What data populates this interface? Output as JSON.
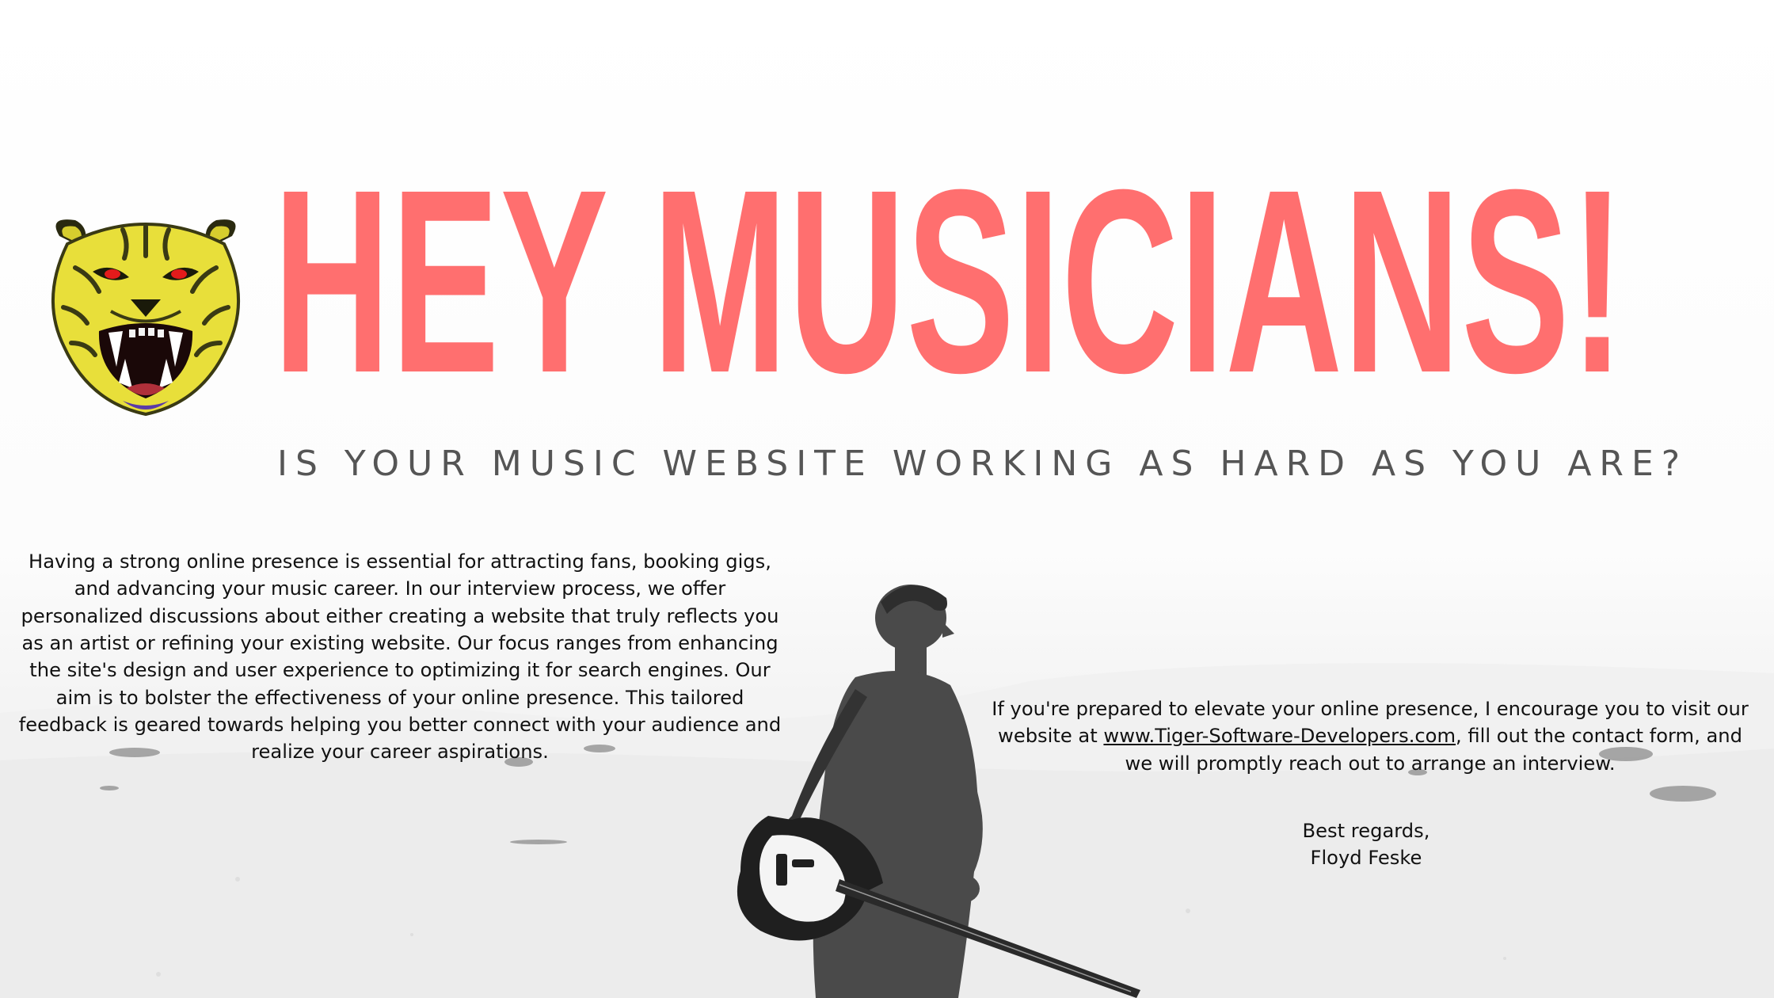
{
  "headline": "HEY MUSICIANS!",
  "subheading": "IS YOUR MUSIC WEBSITE WORKING AS HARD AS YOU ARE?",
  "intro_paragraph": "Having a strong online presence is essential for attracting fans, booking gigs, and advancing your music career. In our interview process, we offer personalized discussions about either creating a website that truly reflects you as an artist or refining your existing website. Our focus ranges from enhancing the site's design and user experience to optimizing it for search engines. Our aim is to bolster the effectiveness of your online presence. This tailored feedback is geared towards helping you better connect with your audience and realize your career aspirations.",
  "cta": {
    "before_link": "If you're prepared to elevate your online presence, I encourage you to visit our website at ",
    "link_text": "www.Tiger-Software-Developers.com",
    "after_link": ", fill out the contact form, and we will promptly reach out to arrange an interview."
  },
  "signoff": {
    "closing": "Best regards,",
    "name": "Floyd Feske"
  },
  "icons": {
    "logo": "tiger-head-icon",
    "background_figure": "guitarist-silhouette-icon"
  },
  "colors": {
    "headline": "#ff6f6f",
    "subheading": "#555555",
    "body_text": "#111111",
    "tiger_yellow": "#e8df3a",
    "tiger_eyes": "#e31b1b"
  }
}
